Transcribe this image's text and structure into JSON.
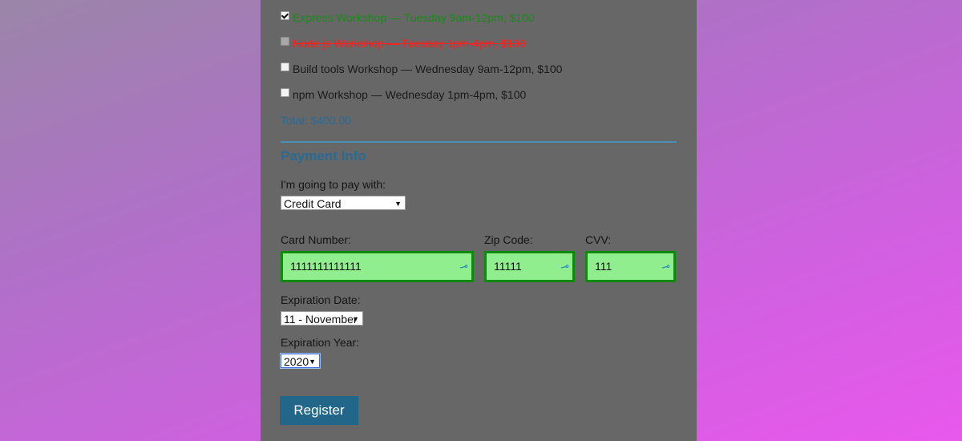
{
  "activities": [
    {
      "label": "Express Workshop — Tuesday 9am-12pm, $100",
      "checked": true,
      "disabled": false
    },
    {
      "label": "Node.js Workshop — Tuesday 1pm-4pm, $100",
      "checked": false,
      "disabled": true
    },
    {
      "label": "Build tools Workshop — Wednesday 9am-12pm, $100",
      "checked": false,
      "disabled": false
    },
    {
      "label": "npm Workshop — Wednesday 1pm-4pm, $100",
      "checked": false,
      "disabled": false
    }
  ],
  "total": "Total: $400.00",
  "payment": {
    "section_title": "Payment Info",
    "pay_with_label": "I'm going to pay with:",
    "pay_with_value": "Credit Card",
    "card_number_label": "Card Number:",
    "card_number_value": "1111111111111",
    "zip_label": "Zip Code:",
    "zip_value": "11111",
    "cvv_label": "CVV:",
    "cvv_value": "111",
    "exp_date_label": "Expiration Date:",
    "exp_date_value": "11 - November",
    "exp_year_label": "Expiration Year:",
    "exp_year_value": "2020"
  },
  "register_label": "Register",
  "colors": {
    "valid_field_bg": "#90ee8f",
    "valid_field_border": "#0f8a0f",
    "accent": "#2b6a92",
    "conflict": "#ff1e1e"
  }
}
